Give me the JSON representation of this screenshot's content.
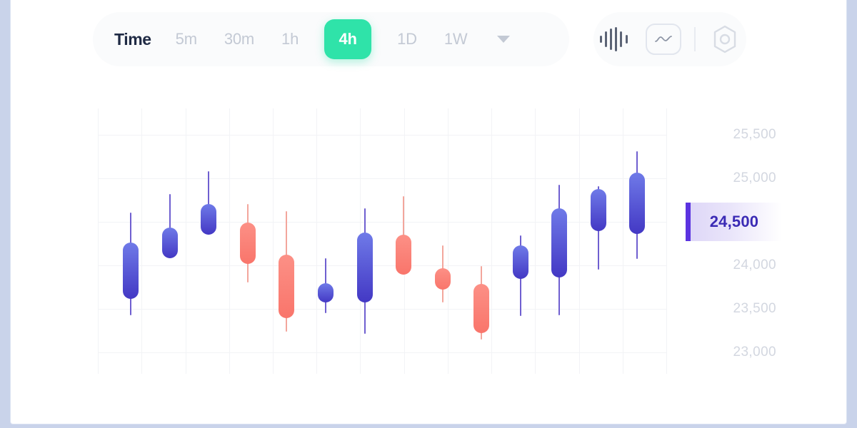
{
  "toolbar": {
    "time_label": "Time",
    "timeframes": [
      {
        "label": "5m",
        "active": false
      },
      {
        "label": "30m",
        "active": false
      },
      {
        "label": "1h",
        "active": false
      },
      {
        "label": "4h",
        "active": true
      },
      {
        "label": "1D",
        "active": false
      },
      {
        "label": "1W",
        "active": false
      }
    ],
    "dropdown_icon": "chevron-down-icon",
    "tools": [
      {
        "name": "waveform-icon",
        "label": "Volume bars"
      },
      {
        "name": "line-chart-icon",
        "label": "Line chart"
      },
      {
        "name": "settings-icon",
        "label": "Settings"
      }
    ],
    "active_color": "#2fe3a9"
  },
  "price_axis": {
    "ticks": [
      "25,500",
      "25,000",
      "24,500",
      "24,000",
      "23,500",
      "23,000"
    ],
    "current_price": "24,500",
    "marker_color": "#5b33e0"
  },
  "chart_data": {
    "type": "candlestick",
    "title": "",
    "xlabel": "",
    "ylabel": "",
    "ylim": [
      22750,
      25800
    ],
    "ytick_values": [
      25500,
      25000,
      24500,
      24000,
      23500,
      23000
    ],
    "ytick_labels": [
      "25,500",
      "25,000",
      "24,500",
      "24,000",
      "23,500",
      "23,000"
    ],
    "grid": true,
    "legend": "none",
    "current_price": 24500,
    "up_color": "#4d42d0",
    "down_color": "#fa8279",
    "candles": [
      {
        "i": 1,
        "open": 24260,
        "close": 23610,
        "high": 24600,
        "low": 23420,
        "dir": "up"
      },
      {
        "i": 2,
        "open": 24430,
        "close": 24080,
        "high": 24820,
        "low": 24080,
        "dir": "up"
      },
      {
        "i": 3,
        "open": 24700,
        "close": 24350,
        "high": 25080,
        "low": 24350,
        "dir": "up"
      },
      {
        "i": 4,
        "open": 24490,
        "close": 24010,
        "high": 24700,
        "low": 23800,
        "dir": "down"
      },
      {
        "i": 5,
        "open": 24120,
        "close": 23390,
        "high": 24620,
        "low": 23230,
        "dir": "down"
      },
      {
        "i": 6,
        "open": 23790,
        "close": 23570,
        "high": 24080,
        "low": 23450,
        "dir": "up"
      },
      {
        "i": 7,
        "open": 24370,
        "close": 23570,
        "high": 24650,
        "low": 23210,
        "dir": "up"
      },
      {
        "i": 8,
        "open": 24350,
        "close": 23890,
        "high": 24790,
        "low": 23890,
        "dir": "down"
      },
      {
        "i": 9,
        "open": 23960,
        "close": 23720,
        "high": 24230,
        "low": 23570,
        "dir": "down"
      },
      {
        "i": 10,
        "open": 23780,
        "close": 23220,
        "high": 23990,
        "low": 23140,
        "dir": "down"
      },
      {
        "i": 11,
        "open": 24230,
        "close": 23840,
        "high": 24340,
        "low": 23410,
        "dir": "up"
      },
      {
        "i": 12,
        "open": 24650,
        "close": 23860,
        "high": 24920,
        "low": 23420,
        "dir": "up"
      },
      {
        "i": 13,
        "open": 24870,
        "close": 24390,
        "high": 24910,
        "low": 23950,
        "dir": "up"
      },
      {
        "i": 14,
        "open": 25060,
        "close": 24360,
        "high": 25310,
        "low": 24070,
        "dir": "up"
      }
    ]
  }
}
